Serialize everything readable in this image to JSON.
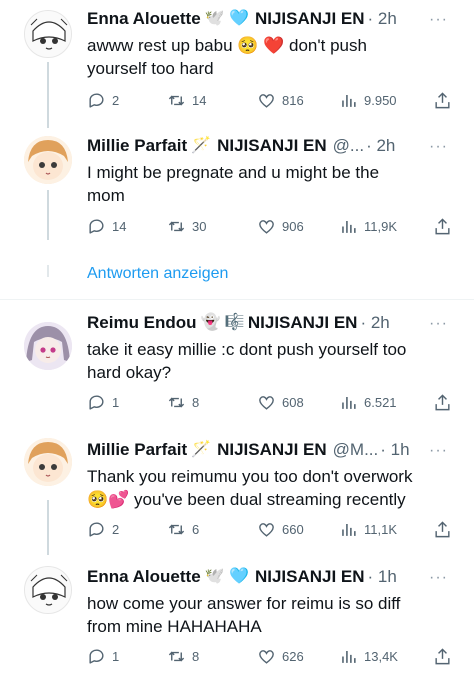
{
  "tweets": [
    {
      "name": "Enna Alouette",
      "emojis": "🕊️ 🩵",
      "affiliation": "NIJISANJI EN",
      "handle": "",
      "time": "· 2h",
      "text_line1": "awww rest up babu 🥺 ❤️  don't push",
      "text_line2": "yourself too hard",
      "replies": "2",
      "retweets": "14",
      "likes": "816",
      "views": "9.950"
    },
    {
      "name": "Millie Parfait",
      "emojis": "🪄",
      "affiliation": "NIJISANJI EN",
      "handle": "@...",
      "time": "· 2h",
      "text_line1": "I might be pregnate and u might be the",
      "text_line2": "mom",
      "replies": "14",
      "retweets": "30",
      "likes": "906",
      "views": "11,9K"
    },
    {
      "name": "Reimu Endou",
      "emojis": "👻 🎼",
      "affiliation": "NIJISANJI EN",
      "handle": "",
      "time": "· 2h",
      "text_line1": "take it easy millie :c dont push yourself too",
      "text_line2": "hard okay?",
      "replies": "1",
      "retweets": "8",
      "likes": "608",
      "views": "6.521"
    },
    {
      "name": "Millie Parfait",
      "emojis": "🪄",
      "affiliation": "NIJISANJI EN",
      "handle": "@M...",
      "time": "· 1h",
      "text_line1": "Thank you reimumu you too don't overwork",
      "text_line2": "🥺💕 you've been dual streaming recently",
      "replies": "2",
      "retweets": "6",
      "likes": "660",
      "views": "11,1K"
    },
    {
      "name": "Enna Alouette",
      "emojis": "🕊️ 🩵",
      "affiliation": "NIJISANJI EN",
      "handle": "",
      "time": "· 1h",
      "text_line1": "how come your answer for reimu is so diff",
      "text_line2": "from mine HAHAHAHA",
      "replies": "1",
      "retweets": "8",
      "likes": "626",
      "views": "13,4K"
    }
  ],
  "show_replies": "Antworten anzeigen",
  "more_icon": "···",
  "colors": {
    "text": "#0f1419",
    "muted": "#536471",
    "link": "#1d9bf0",
    "line": "#cfd9de"
  }
}
